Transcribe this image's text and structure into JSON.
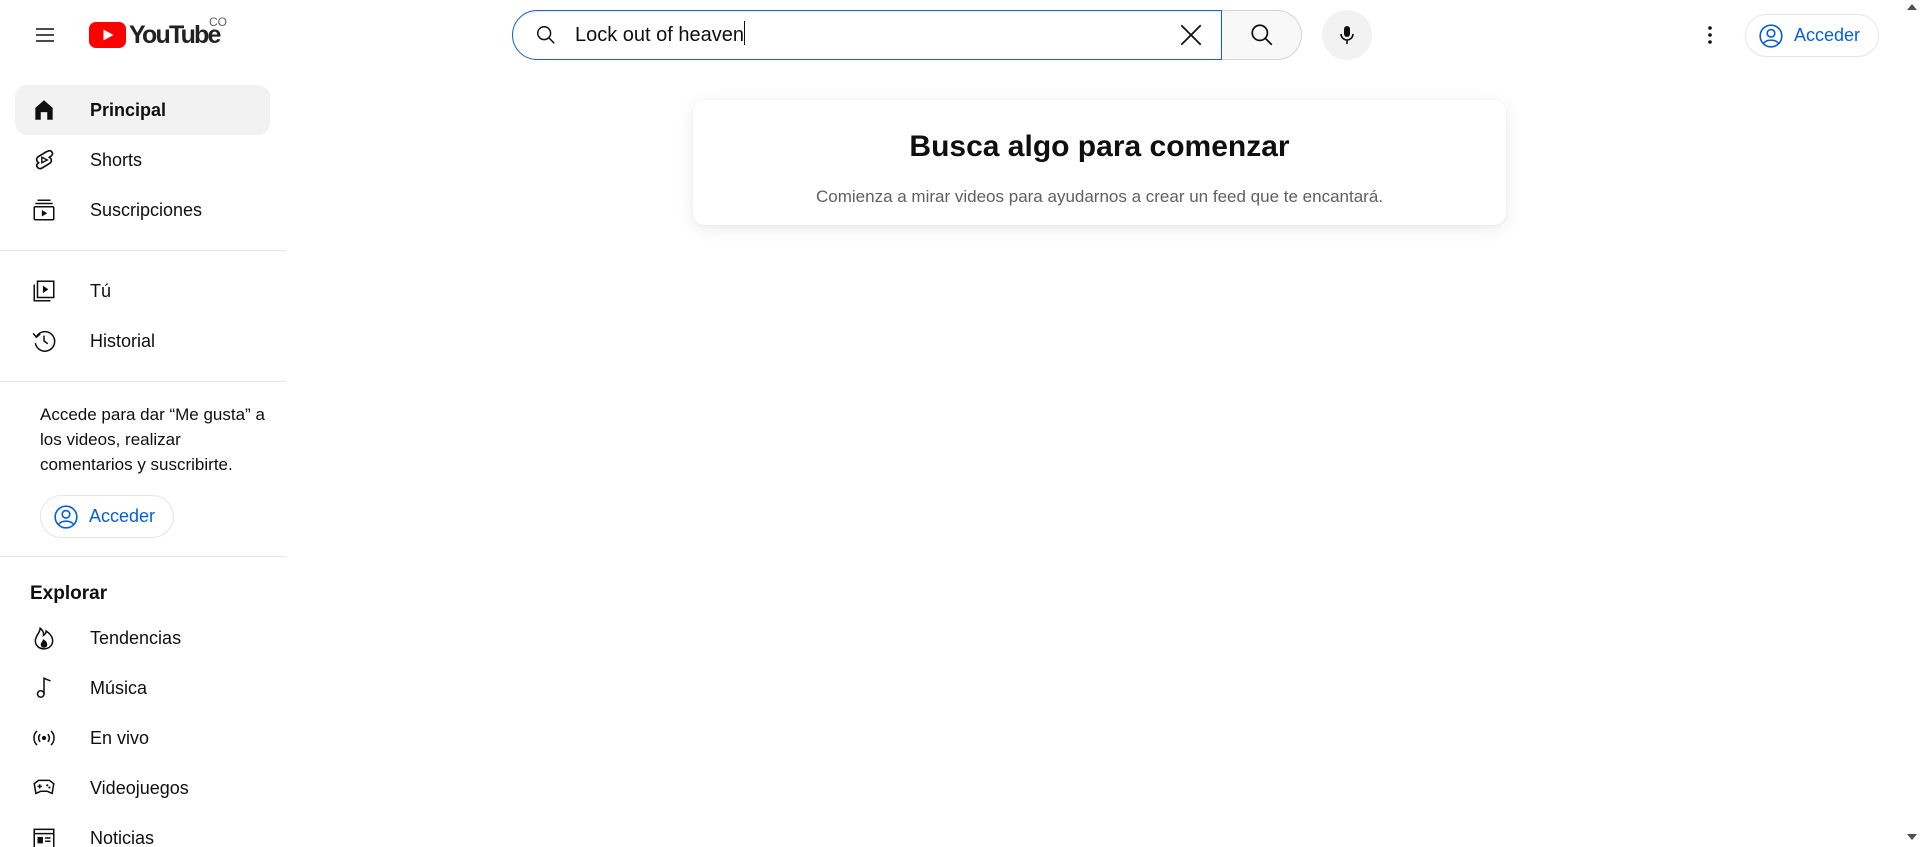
{
  "header": {
    "logo_text": "YouTube",
    "country_code": "CO",
    "search": {
      "value": "Lock out of heaven",
      "clear_icon": "close-icon",
      "submit_icon": "search-icon"
    },
    "mic_icon": "microphone-icon",
    "more_icon": "kebab-icon",
    "signin_label": "Acceder"
  },
  "sidebar": {
    "primary": [
      {
        "label": "Principal",
        "icon": "home-icon",
        "active": true
      },
      {
        "label": "Shorts",
        "icon": "shorts-icon"
      },
      {
        "label": "Suscripciones",
        "icon": "subscriptions-icon"
      }
    ],
    "you": [
      {
        "label": "Tú",
        "icon": "your-channel-icon"
      },
      {
        "label": "Historial",
        "icon": "history-icon"
      }
    ],
    "signin_prompt": "Accede para dar “Me gusta” a los videos, realizar comentarios y suscribirte.",
    "signin_label": "Acceder",
    "explore_title": "Explorar",
    "explore": [
      {
        "label": "Tendencias",
        "icon": "trending-icon"
      },
      {
        "label": "Música",
        "icon": "music-icon"
      },
      {
        "label": "En vivo",
        "icon": "live-icon"
      },
      {
        "label": "Videojuegos",
        "icon": "gaming-icon"
      },
      {
        "label": "Noticias",
        "icon": "news-icon"
      }
    ]
  },
  "main": {
    "empty_title": "Busca algo para comenzar",
    "empty_subtitle": "Comienza a mirar videos para ayudarnos a crear un feed que te encantará."
  },
  "colors": {
    "brand_red": "#ff0000",
    "link_blue": "#065fd4",
    "focus_blue": "#1c62b9"
  }
}
